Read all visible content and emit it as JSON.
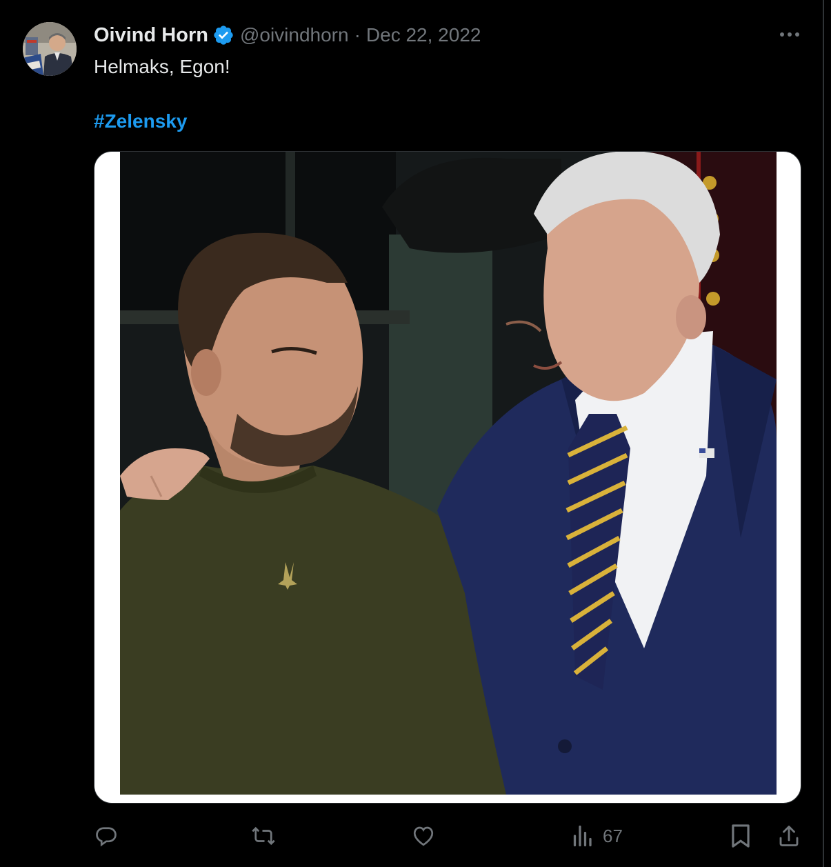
{
  "tweet": {
    "author_name": "Oivind Horn",
    "handle": "@oivindhorn",
    "separator": "·",
    "date": "Dec 22, 2022",
    "text": "Helmaks, Egon!",
    "hashtag": "#Zelensky",
    "verified": true
  },
  "media": {
    "type": "photo"
  },
  "actions": {
    "reply_icon": "speech-bubble-icon",
    "retweet_icon": "retweet-icon",
    "like_icon": "heart-icon",
    "views_icon": "bar-chart-icon",
    "views_count": "67",
    "bookmark_icon": "bookmark-icon",
    "share_icon": "upload-icon"
  },
  "colors": {
    "background": "#000000",
    "text": "#e7e9ea",
    "muted": "#71767b",
    "accent": "#1d9bf0"
  }
}
